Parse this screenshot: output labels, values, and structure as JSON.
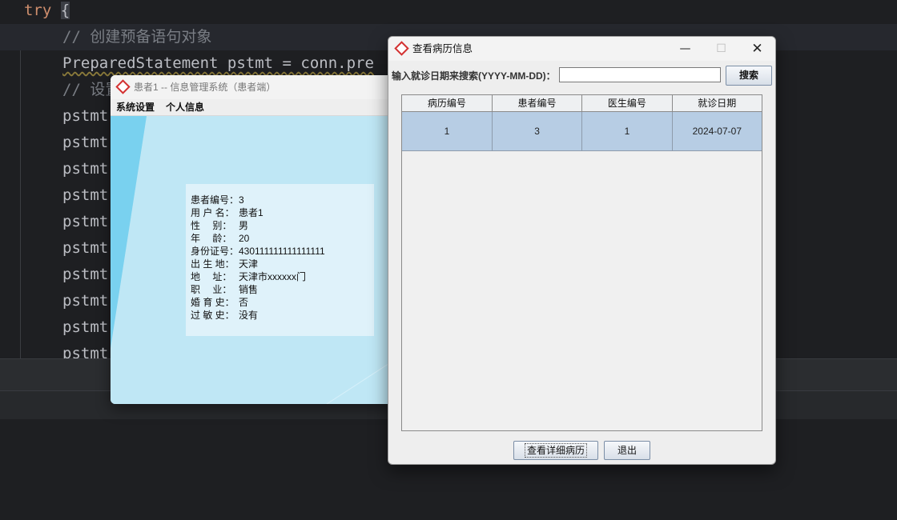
{
  "ide": {
    "lines": {
      "l1_kw": "try",
      "l1_brace": "{",
      "l2": "// 创建预备语句对象",
      "l3": "PreparedStatement pstmt = conn.pre",
      "l4": "// 设置",
      "pstmt": "pstmt"
    }
  },
  "patient_window": {
    "title": "患者1 -- 信息管理系统（患者端）",
    "menu": [
      "系统设置",
      "个人信息"
    ],
    "info": [
      {
        "label": "患者编号：",
        "value": "3"
      },
      {
        "label": "用 户 名：",
        "value": "患者1"
      },
      {
        "label": "性　 别：",
        "value": "男"
      },
      {
        "label": "年　 龄：",
        "value": "20"
      },
      {
        "label": "身份证号：",
        "value": "430111111111111111"
      },
      {
        "label": "出 生 地：",
        "value": "天津"
      },
      {
        "label": "地　 址：",
        "value": "天津市xxxxxx门"
      },
      {
        "label": "职　 业：",
        "value": "销售"
      },
      {
        "label": "婚 育 史：",
        "value": "否"
      },
      {
        "label": "过 敏 史：",
        "value": "没有"
      }
    ]
  },
  "record_window": {
    "title": "查看病历信息",
    "controls": {
      "min": "—",
      "max": "☐",
      "close": "✕"
    },
    "search": {
      "label": "输入就诊日期来搜索(YYYY-MM-DD)：",
      "value": "",
      "button": "搜索"
    },
    "table": {
      "columns": [
        "病历编号",
        "患者编号",
        "医生编号",
        "就诊日期"
      ],
      "rows": [
        [
          "1",
          "3",
          "1",
          "2024-07-07"
        ]
      ]
    },
    "buttons": {
      "detail": "查看详细病历",
      "exit": "退出"
    }
  },
  "colors": {
    "ide_bg": "#1e1f22",
    "patient_bg": "#bfe7f5",
    "selected_row": "#b7cde4",
    "logo_red": "#d33131"
  }
}
